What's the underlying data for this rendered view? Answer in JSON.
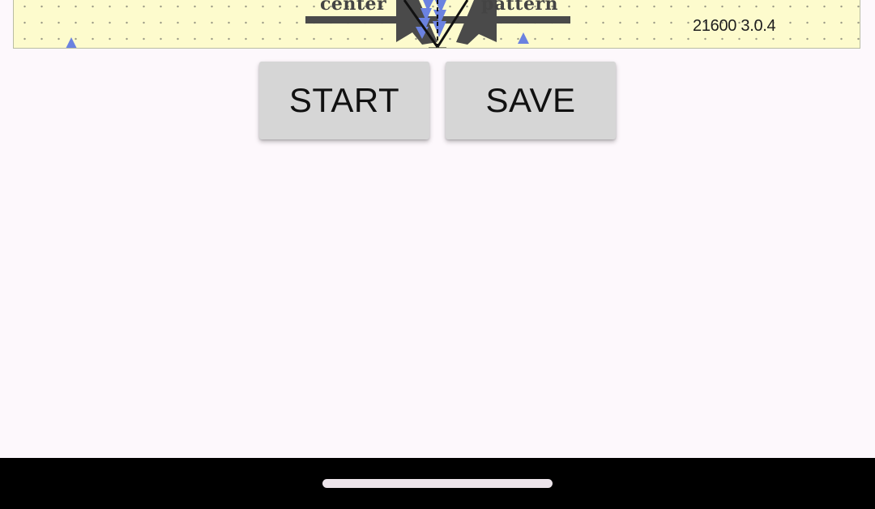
{
  "pattern_panel": {
    "label_center": "center",
    "label_pattern": "pattern",
    "version": "21600 3.0.4",
    "colors": {
      "background": "#fdfbcd",
      "marker": "#6b82e0",
      "bar": "#4a4a4a",
      "needle": "#111111"
    }
  },
  "buttons": {
    "start_label": "START",
    "save_label": "SAVE"
  },
  "nav": {
    "home_handle": "home-gesture-bar"
  }
}
